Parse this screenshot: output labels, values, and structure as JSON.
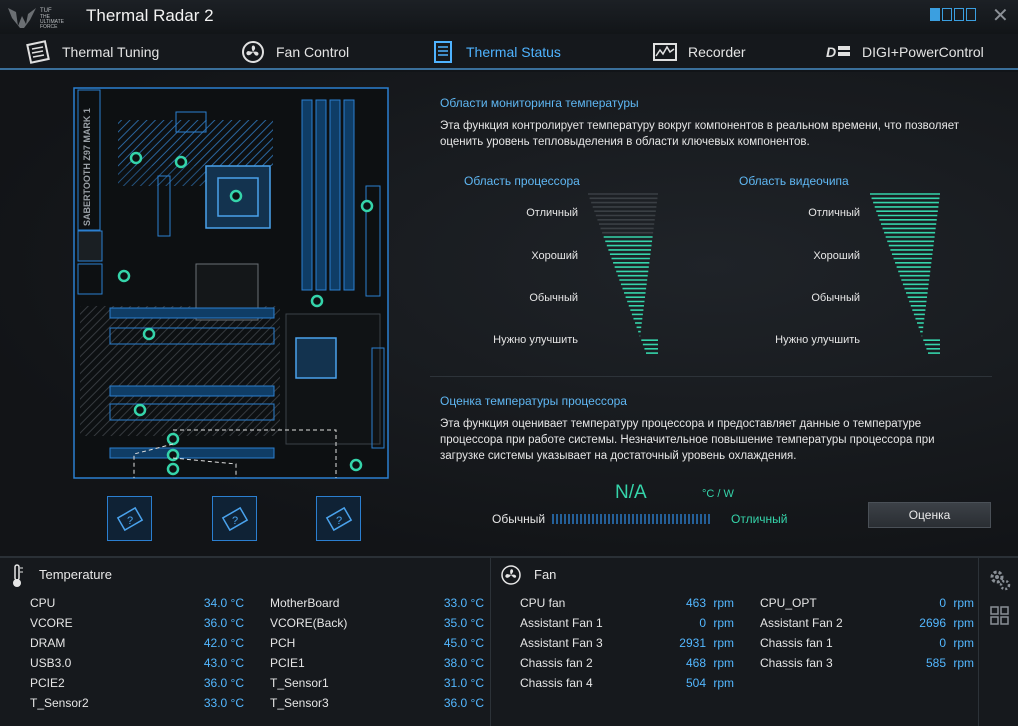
{
  "window": {
    "title": "Thermal Radar 2",
    "logo_text": [
      "TUF",
      "THE",
      "ULTIMATE",
      "FORCE"
    ]
  },
  "tabs": [
    {
      "label": "Thermal Tuning",
      "icon": "thermal-tuning-icon",
      "active": false
    },
    {
      "label": "Fan Control",
      "icon": "fan-icon",
      "active": false
    },
    {
      "label": "Thermal Status",
      "icon": "thermal-status-icon",
      "active": true
    },
    {
      "label": "Recorder",
      "icon": "recorder-icon",
      "active": false
    },
    {
      "label": "DIGI+PowerControl",
      "icon": "digi-icon",
      "active": false
    }
  ],
  "board": {
    "model_text": "SABERTOOTH Z97 MARK 1"
  },
  "monitoring": {
    "title": "Области мониторинга температуры",
    "desc_line1": "Эта функция контролирует температуру вокруг компонентов в реальном времени, что позволяет",
    "desc_line2": "оценить уровень тепловыделения в области ключевых компонентов.",
    "cpu_area": "Область процессора",
    "gpu_area": "Область видеочипа",
    "levels": [
      "Отличный",
      "Хороший",
      "Обычный",
      "Нужно улучшить"
    ]
  },
  "cpu_eval": {
    "title": "Оценка температуры процессора",
    "desc_line1": "Эта функция оценивает температуру процессора и предоставляет данные о температуре",
    "desc_line2": "процессора при работе системы. Незначительное повышение температуры процессора при",
    "desc_line3": "загрузке системы указывает на достаточный уровень охлаждения.",
    "value": "N/A",
    "unit": "°C / W",
    "scale_left": "Обычный",
    "scale_right": "Отличный",
    "button": "Оценка"
  },
  "temperature": {
    "title": "Temperature",
    "rows": [
      {
        "name": "CPU",
        "value": "34.0 °C"
      },
      {
        "name": "MotherBoard",
        "value": "33.0 °C"
      },
      {
        "name": "VCORE",
        "value": "36.0 °C"
      },
      {
        "name": "VCORE(Back)",
        "value": "35.0 °C"
      },
      {
        "name": "DRAM",
        "value": "42.0 °C"
      },
      {
        "name": "PCH",
        "value": "45.0 °C"
      },
      {
        "name": "USB3.0",
        "value": "43.0 °C"
      },
      {
        "name": "PCIE1",
        "value": "38.0 °C"
      },
      {
        "name": "PCIE2",
        "value": "36.0 °C"
      },
      {
        "name": "T_Sensor1",
        "value": "31.0 °C"
      },
      {
        "name": "T_Sensor2",
        "value": "33.0 °C"
      },
      {
        "name": "T_Sensor3",
        "value": "36.0 °C"
      }
    ]
  },
  "fan": {
    "title": "Fan",
    "rows": [
      {
        "name": "CPU fan",
        "value": "463",
        "unit": "rpm"
      },
      {
        "name": "CPU_OPT",
        "value": "0",
        "unit": "rpm"
      },
      {
        "name": "Assistant Fan 1",
        "value": "0",
        "unit": "rpm"
      },
      {
        "name": "Assistant Fan 2",
        "value": "2696",
        "unit": "rpm"
      },
      {
        "name": "Assistant Fan 3",
        "value": "2931",
        "unit": "rpm"
      },
      {
        "name": "Chassis fan 1",
        "value": "0",
        "unit": "rpm"
      },
      {
        "name": "Chassis fan 2",
        "value": "468",
        "unit": "rpm"
      },
      {
        "name": "Chassis fan 3",
        "value": "585",
        "unit": "rpm"
      },
      {
        "name": "Chassis fan 4",
        "value": "504",
        "unit": "rpm"
      }
    ]
  },
  "colors": {
    "accent": "#4fb3ff",
    "gauge": "#35d4aa",
    "value_blue": "#53b7ff"
  }
}
